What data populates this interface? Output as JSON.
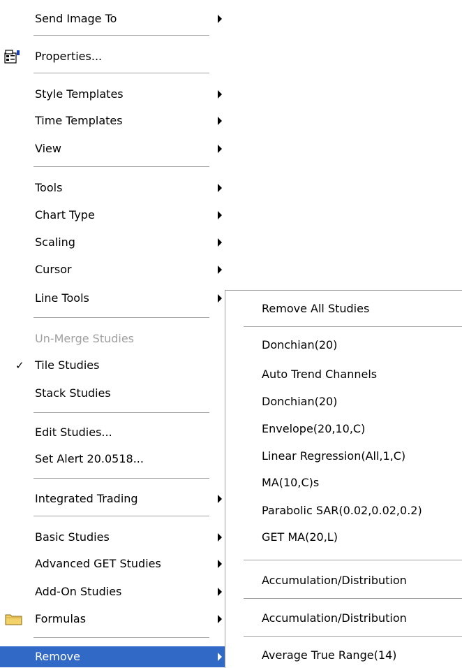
{
  "main_menu": {
    "send_image_to": "Send Image To",
    "properties": "Properties...",
    "style_templates": "Style Templates",
    "time_templates": "Time Templates",
    "view": "View",
    "tools": "Tools",
    "chart_type": "Chart Type",
    "scaling": "Scaling",
    "cursor": "Cursor",
    "line_tools": "Line Tools",
    "un_merge_studies": "Un-Merge Studies",
    "tile_studies": "Tile Studies",
    "tile_studies_checked": true,
    "stack_studies": "Stack Studies",
    "edit_studies": "Edit Studies...",
    "set_alert": "Set Alert 20.0518...",
    "integrated_trading": "Integrated Trading",
    "basic_studies": "Basic Studies",
    "advanced_get_studies": "Advanced GET Studies",
    "add_on_studies": "Add-On Studies",
    "formulas": "Formulas",
    "remove": "Remove"
  },
  "remove_submenu": {
    "remove_all": "Remove All Studies",
    "items": [
      "Donchian(20)",
      "Auto Trend Channels",
      "Donchian(20)",
      "Envelope(20,10,C)",
      "Linear Regression(All,1,C)",
      "MA(10,C)s",
      "Parabolic SAR(0.02,0.02,0.2)",
      "GET MA(20,L)"
    ],
    "accumulation_1": "Accumulation/Distribution",
    "accumulation_2": "Accumulation/Distribution",
    "average_true_range": "Average True Range(14)"
  },
  "colors": {
    "highlight": "#3169c6",
    "disabled_text": "#a0a0a0",
    "separator": "#a0a0a0"
  },
  "icons": {
    "check": "✓",
    "properties": "properties-icon",
    "formulas": "folder-icon",
    "submenu": "submenu-arrow-icon"
  }
}
